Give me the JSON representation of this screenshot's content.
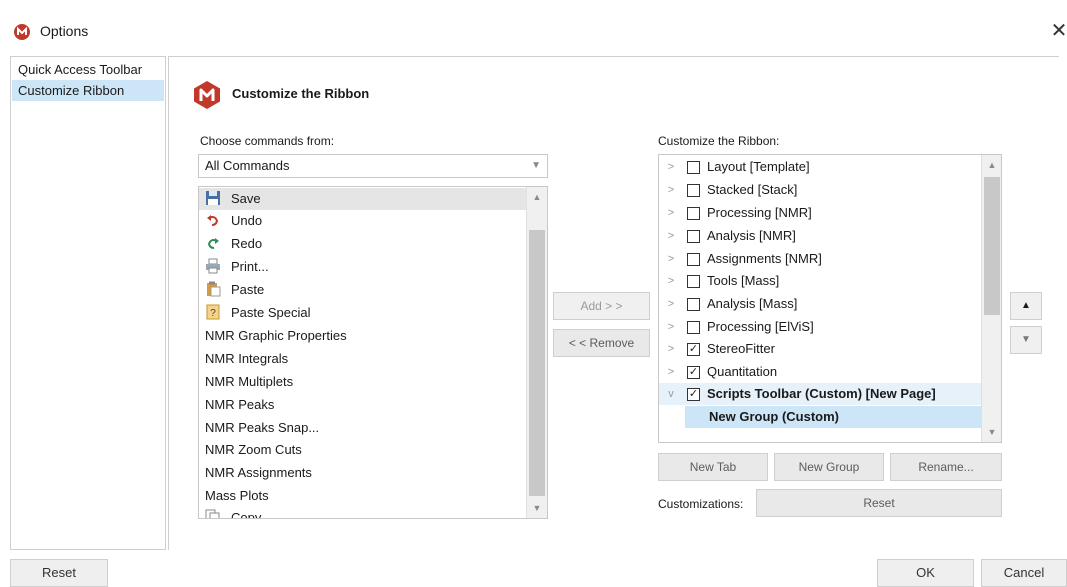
{
  "window": {
    "title": "Options",
    "close_glyph": "✕"
  },
  "nav": {
    "items": [
      {
        "label": "Quick Access Toolbar",
        "selected": false
      },
      {
        "label": "Customize Ribbon",
        "selected": true
      }
    ]
  },
  "header": {
    "title": "Customize the Ribbon"
  },
  "left": {
    "label": "Choose commands from:",
    "dropdown_value": "All Commands",
    "commands": [
      {
        "label": "Save",
        "icon": "save-icon",
        "selected": true
      },
      {
        "label": "Undo",
        "icon": "undo-icon"
      },
      {
        "label": "Redo",
        "icon": "redo-icon"
      },
      {
        "label": "Print...",
        "icon": "print-icon"
      },
      {
        "label": "Paste",
        "icon": "paste-icon"
      },
      {
        "label": "Paste Special",
        "icon": "paste-special-icon"
      },
      {
        "label": "NMR Graphic Properties"
      },
      {
        "label": "NMR Integrals"
      },
      {
        "label": "NMR Multiplets"
      },
      {
        "label": "NMR Peaks"
      },
      {
        "label": "NMR Peaks  Snap..."
      },
      {
        "label": "NMR Zoom  Cuts"
      },
      {
        "label": "NMR Assignments"
      },
      {
        "label": "Mass Plots"
      },
      {
        "label": "Copy",
        "icon": "copy-icon"
      }
    ]
  },
  "middle": {
    "add_label": "Add > >",
    "remove_label": "< < Remove"
  },
  "right": {
    "label": "Customize the Ribbon:",
    "tree": [
      {
        "label": "Layout [Template]",
        "checked": false
      },
      {
        "label": "Stacked [Stack]",
        "checked": false
      },
      {
        "label": "Processing [NMR]",
        "checked": false
      },
      {
        "label": "Analysis [NMR]",
        "checked": false
      },
      {
        "label": "Assignments [NMR]",
        "checked": false
      },
      {
        "label": "Tools [Mass]",
        "checked": false
      },
      {
        "label": "Analysis [Mass]",
        "checked": false
      },
      {
        "label": "Processing [ElViS]",
        "checked": false
      },
      {
        "label": "StereoFitter",
        "checked": true
      },
      {
        "label": "Quantitation",
        "checked": true
      },
      {
        "label": "Scripts Toolbar (Custom) [New Page]",
        "checked": true,
        "expanded": true,
        "bold": true
      },
      {
        "label": "New Group (Custom)",
        "child": true,
        "bold": true,
        "highlighted": true
      }
    ],
    "new_tab_label": "New Tab",
    "new_group_label": "New Group",
    "rename_label": "Rename...",
    "customizations_label": "Customizations:",
    "reset_label": "Reset"
  },
  "footer": {
    "reset_label": "Reset",
    "ok_label": "OK",
    "cancel_label": "Cancel"
  },
  "colors": {
    "accent": "#cde6f7",
    "brand": "#c0392b"
  }
}
